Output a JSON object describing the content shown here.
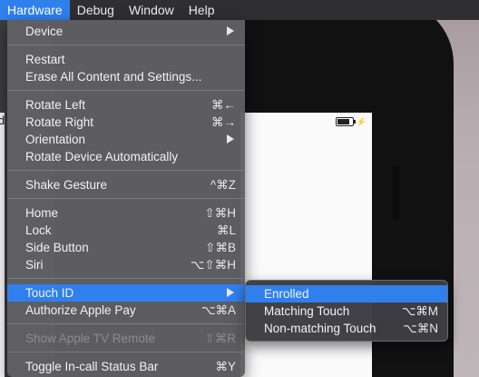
{
  "menubar": {
    "items": [
      {
        "label": "Hardware",
        "active": true
      },
      {
        "label": "Debug"
      },
      {
        "label": "Window"
      },
      {
        "label": "Help"
      }
    ]
  },
  "hardware_menu": {
    "device": {
      "label": "Device"
    },
    "restart": {
      "label": "Restart"
    },
    "erase": {
      "label": "Erase All Content and Settings..."
    },
    "rotate_left": {
      "label": "Rotate Left",
      "shortcut": "⌘←"
    },
    "rotate_right": {
      "label": "Rotate Right",
      "shortcut": "⌘→"
    },
    "orientation": {
      "label": "Orientation"
    },
    "rotate_auto": {
      "label": "Rotate Device Automatically"
    },
    "shake": {
      "label": "Shake Gesture",
      "shortcut": "^⌘Z"
    },
    "home": {
      "label": "Home",
      "shortcut": "⇧⌘H"
    },
    "lock": {
      "label": "Lock",
      "shortcut": "⌘L"
    },
    "side_button": {
      "label": "Side Button",
      "shortcut": "⇧⌘B"
    },
    "siri": {
      "label": "Siri",
      "shortcut": "⌥⇧⌘H"
    },
    "touch_id": {
      "label": "Touch ID",
      "highlighted": true
    },
    "apple_pay": {
      "label": "Authorize Apple Pay",
      "shortcut": "⌥⌘A"
    },
    "apple_tv_remote": {
      "label": "Show Apple TV Remote",
      "shortcut": "⇧⌘R",
      "disabled": true
    },
    "toggle_status_bar": {
      "label": "Toggle In-call Status Bar",
      "shortcut": "⌘Y"
    }
  },
  "touch_id_submenu": {
    "enrolled": {
      "label": "Enrolled",
      "highlighted": true
    },
    "matching": {
      "label": "Matching Touch",
      "shortcut": "⌥⌘M"
    },
    "non_matching": {
      "label": "Non-matching Touch",
      "shortcut": "⌥⌘N"
    }
  },
  "simulator": {
    "left_edge_glyph": "d",
    "charging_symbol": "⚡",
    "battery_level": 0.8
  },
  "colors": {
    "highlight": "#2f80ed",
    "menu_bg": "#5f5f64",
    "submenu_bg": "#3e3e42",
    "menubar_bg": "#2f2f32"
  }
}
